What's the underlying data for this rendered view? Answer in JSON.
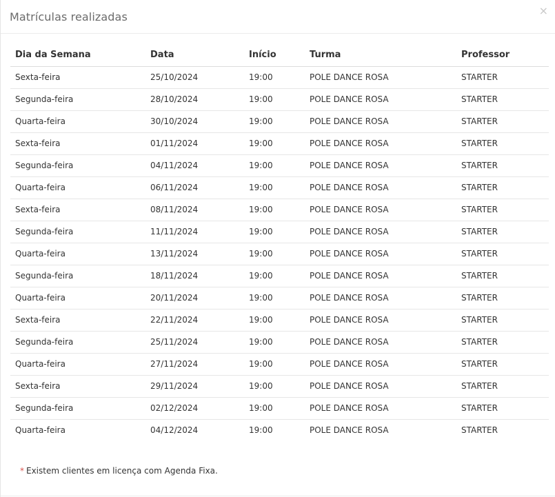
{
  "modal": {
    "title": "Matrículas realizadas",
    "close_label": "×"
  },
  "table": {
    "headers": [
      "Dia da Semana",
      "Data",
      "Início",
      "Turma",
      "Professor"
    ],
    "rows": [
      [
        "Sexta-feira",
        "25/10/2024",
        "19:00",
        "POLE DANCE ROSA",
        "STARTER"
      ],
      [
        "Segunda-feira",
        "28/10/2024",
        "19:00",
        "POLE DANCE ROSA",
        "STARTER"
      ],
      [
        "Quarta-feira",
        "30/10/2024",
        "19:00",
        "POLE DANCE ROSA",
        "STARTER"
      ],
      [
        "Sexta-feira",
        "01/11/2024",
        "19:00",
        "POLE DANCE ROSA",
        "STARTER"
      ],
      [
        "Segunda-feira",
        "04/11/2024",
        "19:00",
        "POLE DANCE ROSA",
        "STARTER"
      ],
      [
        "Quarta-feira",
        "06/11/2024",
        "19:00",
        "POLE DANCE ROSA",
        "STARTER"
      ],
      [
        "Sexta-feira",
        "08/11/2024",
        "19:00",
        "POLE DANCE ROSA",
        "STARTER"
      ],
      [
        "Segunda-feira",
        "11/11/2024",
        "19:00",
        "POLE DANCE ROSA",
        "STARTER"
      ],
      [
        "Quarta-feira",
        "13/11/2024",
        "19:00",
        "POLE DANCE ROSA",
        "STARTER"
      ],
      [
        "Segunda-feira",
        "18/11/2024",
        "19:00",
        "POLE DANCE ROSA",
        "STARTER"
      ],
      [
        "Quarta-feira",
        "20/11/2024",
        "19:00",
        "POLE DANCE ROSA",
        "STARTER"
      ],
      [
        "Sexta-feira",
        "22/11/2024",
        "19:00",
        "POLE DANCE ROSA",
        "STARTER"
      ],
      [
        "Segunda-feira",
        "25/11/2024",
        "19:00",
        "POLE DANCE ROSA",
        "STARTER"
      ],
      [
        "Quarta-feira",
        "27/11/2024",
        "19:00",
        "POLE DANCE ROSA",
        "STARTER"
      ],
      [
        "Sexta-feira",
        "29/11/2024",
        "19:00",
        "POLE DANCE ROSA",
        "STARTER"
      ],
      [
        "Segunda-feira",
        "02/12/2024",
        "19:00",
        "POLE DANCE ROSA",
        "STARTER"
      ],
      [
        "Quarta-feira",
        "04/12/2024",
        "19:00",
        "POLE DANCE ROSA",
        "STARTER"
      ]
    ]
  },
  "footnote": {
    "marker": "*",
    "text": "Existem clientes em licença com Agenda Fixa."
  },
  "colors": {
    "asterisk": "#d9534f",
    "title": "#6b6b6b",
    "text": "#333333"
  }
}
